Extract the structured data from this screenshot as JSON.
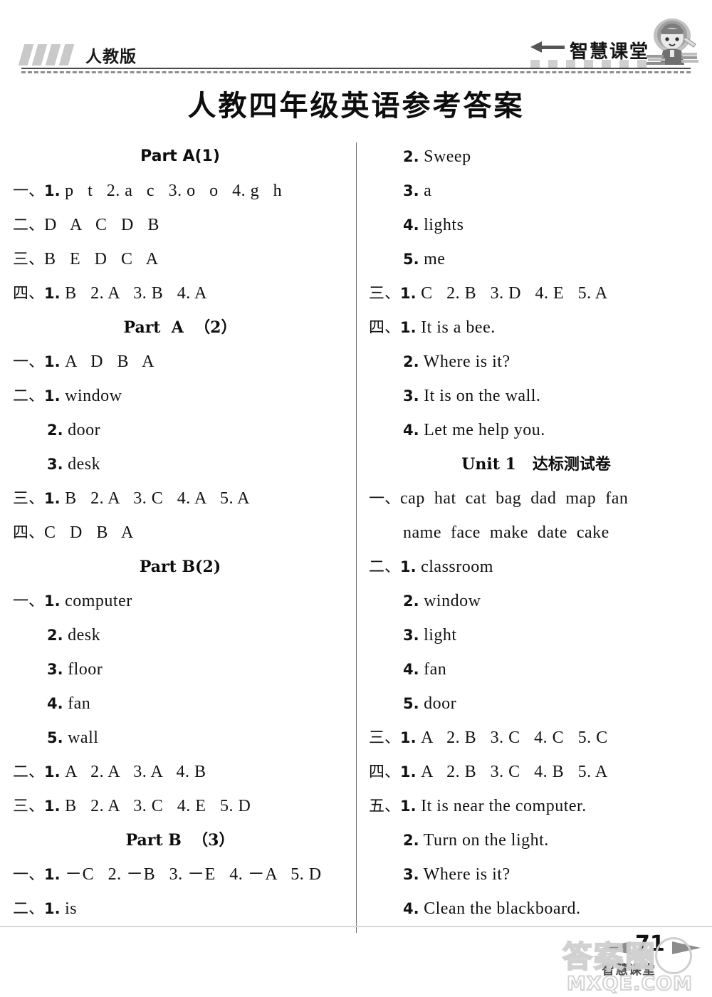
{
  "header": {
    "publisher": "人教版",
    "brand": "智慧课堂",
    "arrow_icon": "left-arrow-icon",
    "girl_icon": "student-girl-icon"
  },
  "title": "人教四年级英语参考答案",
  "columns": {
    "left": [
      {
        "kind": "heading",
        "style": "sans",
        "text": "Part A(1)"
      },
      {
        "kind": "line",
        "indent": false,
        "cn": "一、",
        "num": "1.",
        "txt": "p   t   2. a   c   3. o   o   4. g   h"
      },
      {
        "kind": "line",
        "indent": false,
        "cn": "二、",
        "num": "",
        "txt": "D   A   C   D   B"
      },
      {
        "kind": "line",
        "indent": false,
        "cn": "三、",
        "num": "",
        "txt": "B   E   D   C   A"
      },
      {
        "kind": "line",
        "indent": false,
        "cn": "四、",
        "num": "1.",
        "txt": "B   2. A   3. B   4. A"
      },
      {
        "kind": "heading",
        "style": "serif",
        "text": "Part  A  （2）"
      },
      {
        "kind": "line",
        "indent": false,
        "cn": "一、",
        "num": "1.",
        "txt": "A   D   B   A"
      },
      {
        "kind": "line",
        "indent": false,
        "cn": "二、",
        "num": "1.",
        "txt": "window"
      },
      {
        "kind": "line",
        "indent": true,
        "cn": "",
        "num": "2.",
        "txt": "door"
      },
      {
        "kind": "line",
        "indent": true,
        "cn": "",
        "num": "3.",
        "txt": "desk"
      },
      {
        "kind": "line",
        "indent": false,
        "cn": "三、",
        "num": "1.",
        "txt": "B   2. A   3. C   4. A   5. A"
      },
      {
        "kind": "line",
        "indent": false,
        "cn": "四、",
        "num": "",
        "txt": "C   D   B   A"
      },
      {
        "kind": "heading",
        "style": "serif",
        "text": "Part B(2)"
      },
      {
        "kind": "line",
        "indent": false,
        "cn": "一、",
        "num": "1.",
        "txt": "computer"
      },
      {
        "kind": "line",
        "indent": true,
        "cn": "",
        "num": "2.",
        "txt": "desk"
      },
      {
        "kind": "line",
        "indent": true,
        "cn": "",
        "num": "3.",
        "txt": "floor"
      },
      {
        "kind": "line",
        "indent": true,
        "cn": "",
        "num": "4.",
        "txt": "fan"
      },
      {
        "kind": "line",
        "indent": true,
        "cn": "",
        "num": "5.",
        "txt": "wall"
      },
      {
        "kind": "line",
        "indent": false,
        "cn": "二、",
        "num": "1.",
        "txt": "A   2. A   3. A   4. B"
      },
      {
        "kind": "line",
        "indent": false,
        "cn": "三、",
        "num": "1.",
        "txt": "B   2. A   3. C   4. E   5. D"
      },
      {
        "kind": "heading",
        "style": "serif",
        "text": "Part B  （3）"
      },
      {
        "kind": "line",
        "indent": false,
        "cn": "一、",
        "num": "1.",
        "txt": "－C   2. －B   3. －E   4. －A   5. D"
      },
      {
        "kind": "line",
        "indent": false,
        "cn": "二、",
        "num": "1.",
        "txt": "is"
      }
    ],
    "right": [
      {
        "kind": "line",
        "indent": true,
        "cn": "",
        "num": "2.",
        "txt": "Sweep"
      },
      {
        "kind": "line",
        "indent": true,
        "cn": "",
        "num": "3.",
        "txt": "a"
      },
      {
        "kind": "line",
        "indent": true,
        "cn": "",
        "num": "4.",
        "txt": "lights"
      },
      {
        "kind": "line",
        "indent": true,
        "cn": "",
        "num": "5.",
        "txt": "me"
      },
      {
        "kind": "line",
        "indent": false,
        "cn": "三、",
        "num": "1.",
        "txt": "C   2. B   3. D   4. E   5. A"
      },
      {
        "kind": "line",
        "indent": false,
        "cn": "四、",
        "num": "1.",
        "txt": "It is a bee."
      },
      {
        "kind": "line",
        "indent": true,
        "cn": "",
        "num": "2.",
        "txt": "Where is it?"
      },
      {
        "kind": "line",
        "indent": true,
        "cn": "",
        "num": "3.",
        "txt": "It is on the wall."
      },
      {
        "kind": "line",
        "indent": true,
        "cn": "",
        "num": "4.",
        "txt": "Let me help you."
      },
      {
        "kind": "heading",
        "style": "serif",
        "text": "Unit 1   达标测试卷"
      },
      {
        "kind": "line",
        "indent": false,
        "cn": "一、",
        "num": "",
        "txt": "cap  hat  cat  bag  dad  map  fan"
      },
      {
        "kind": "line",
        "indent": true,
        "cn": "",
        "num": "",
        "txt": "name  face  make  date  cake"
      },
      {
        "kind": "line",
        "indent": false,
        "cn": "二、",
        "num": "1.",
        "txt": "classroom"
      },
      {
        "kind": "line",
        "indent": true,
        "cn": "",
        "num": "2.",
        "txt": "window"
      },
      {
        "kind": "line",
        "indent": true,
        "cn": "",
        "num": "3.",
        "txt": "light"
      },
      {
        "kind": "line",
        "indent": true,
        "cn": "",
        "num": "4.",
        "txt": "fan"
      },
      {
        "kind": "line",
        "indent": true,
        "cn": "",
        "num": "5.",
        "txt": "door"
      },
      {
        "kind": "line",
        "indent": false,
        "cn": "三、",
        "num": "1.",
        "txt": "A   2. B   3. C   4. C   5. C"
      },
      {
        "kind": "line",
        "indent": false,
        "cn": "四、",
        "num": "1.",
        "txt": "A   2. B   3. C   4. B   5. A"
      },
      {
        "kind": "line",
        "indent": false,
        "cn": "五、",
        "num": "1.",
        "txt": "It is near the computer."
      },
      {
        "kind": "line",
        "indent": true,
        "cn": "",
        "num": "2.",
        "txt": "Turn on the light."
      },
      {
        "kind": "line",
        "indent": true,
        "cn": "",
        "num": "3.",
        "txt": "Where is it?"
      },
      {
        "kind": "line",
        "indent": true,
        "cn": "",
        "num": "4.",
        "txt": "Clean the blackboard."
      }
    ]
  },
  "footer": {
    "page_number": "71",
    "brand": "智慧课堂"
  },
  "watermark": {
    "cn": "答案圈",
    "url": "MXQE.COM"
  }
}
